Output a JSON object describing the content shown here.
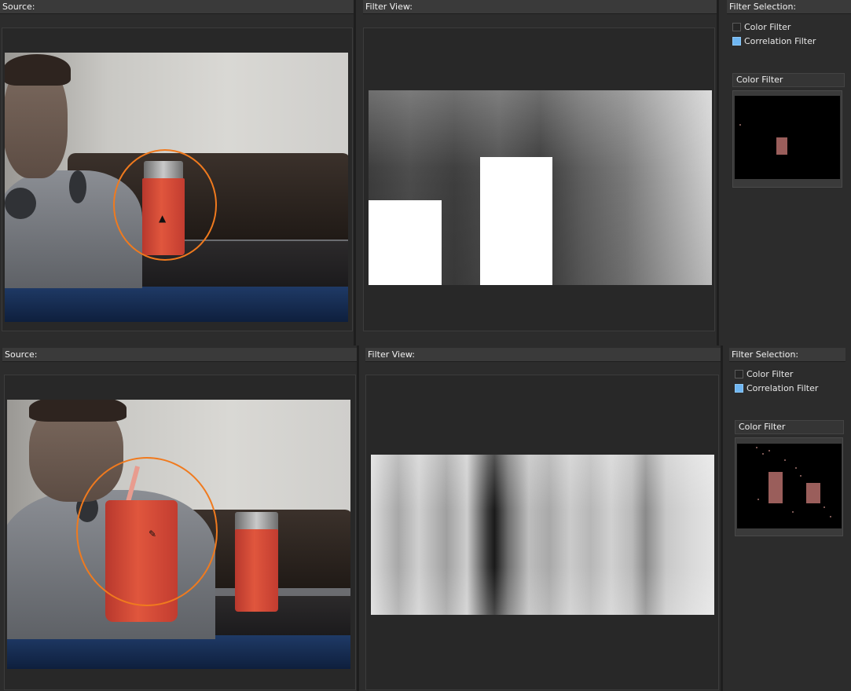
{
  "panels": [
    {
      "source_label": "Source:",
      "filter_view_label": "Filter View:",
      "filter_selection_label": "Filter Selection:",
      "options": [
        {
          "label": "Color Filter",
          "checked": false
        },
        {
          "label": "Correlation Filter",
          "checked": true
        }
      ],
      "color_filter_title": "Color Filter"
    },
    {
      "source_label": "Source:",
      "filter_view_label": "Filter View:",
      "filter_selection_label": "Filter Selection:",
      "options": [
        {
          "label": "Color Filter",
          "checked": false
        },
        {
          "label": "Correlation Filter",
          "checked": true
        }
      ],
      "color_filter_title": "Color Filter"
    }
  ],
  "colors": {
    "background": "#2a2a2a",
    "header": "#3a3a3a",
    "checkbox_checked": "#6fb6f2",
    "tracking_circle": "#f07a1e"
  }
}
